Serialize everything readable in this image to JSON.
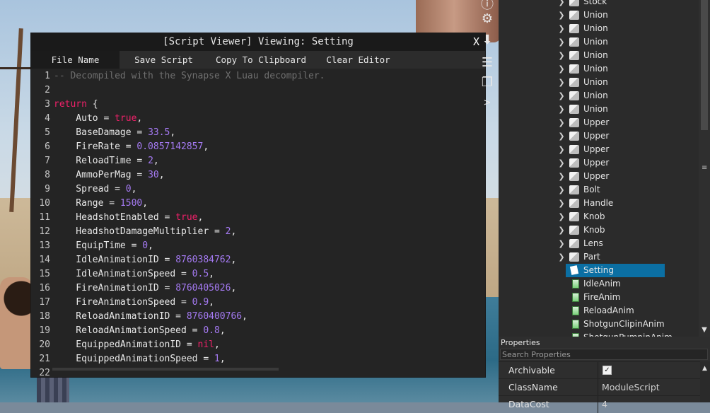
{
  "viewer": {
    "title": "[Script Viewer] Viewing: Setting",
    "close_label": "X",
    "tabs": [
      {
        "label": "File Name"
      },
      {
        "label": "Save Script"
      },
      {
        "label": "Copy To Clipboard"
      },
      {
        "label": "Clear Editor"
      }
    ],
    "lines": [
      {
        "n": "1",
        "tokens": [
          {
            "t": "-- Decompiled with the Synapse X Luau decompiler.",
            "c": "cm"
          }
        ]
      },
      {
        "n": "2",
        "tokens": []
      },
      {
        "n": "3",
        "tokens": [
          {
            "t": "return",
            "c": "kw"
          },
          {
            "t": " {",
            "c": "op"
          }
        ]
      },
      {
        "n": "4",
        "tokens": [
          {
            "t": "    Auto = ",
            "c": "op"
          },
          {
            "t": "true",
            "c": "kw"
          },
          {
            "t": ",",
            "c": "op"
          }
        ]
      },
      {
        "n": "5",
        "tokens": [
          {
            "t": "    BaseDamage = ",
            "c": "op"
          },
          {
            "t": "33.5",
            "c": "num"
          },
          {
            "t": ",",
            "c": "op"
          }
        ]
      },
      {
        "n": "6",
        "tokens": [
          {
            "t": "    FireRate = ",
            "c": "op"
          },
          {
            "t": "0.0857142857",
            "c": "num"
          },
          {
            "t": ",",
            "c": "op"
          }
        ]
      },
      {
        "n": "7",
        "tokens": [
          {
            "t": "    ReloadTime = ",
            "c": "op"
          },
          {
            "t": "2",
            "c": "num"
          },
          {
            "t": ",",
            "c": "op"
          }
        ]
      },
      {
        "n": "8",
        "tokens": [
          {
            "t": "    AmmoPerMag = ",
            "c": "op"
          },
          {
            "t": "30",
            "c": "num"
          },
          {
            "t": ",",
            "c": "op"
          }
        ]
      },
      {
        "n": "9",
        "tokens": [
          {
            "t": "    Spread = ",
            "c": "op"
          },
          {
            "t": "0",
            "c": "num"
          },
          {
            "t": ",",
            "c": "op"
          }
        ]
      },
      {
        "n": "10",
        "tokens": [
          {
            "t": "    Range = ",
            "c": "op"
          },
          {
            "t": "1500",
            "c": "num"
          },
          {
            "t": ",",
            "c": "op"
          }
        ]
      },
      {
        "n": "11",
        "tokens": [
          {
            "t": "    HeadshotEnabled = ",
            "c": "op"
          },
          {
            "t": "true",
            "c": "kw"
          },
          {
            "t": ",",
            "c": "op"
          }
        ]
      },
      {
        "n": "12",
        "tokens": [
          {
            "t": "    HeadshotDamageMultiplier = ",
            "c": "op"
          },
          {
            "t": "2",
            "c": "num"
          },
          {
            "t": ",",
            "c": "op"
          }
        ]
      },
      {
        "n": "13",
        "tokens": [
          {
            "t": "    EquipTime = ",
            "c": "op"
          },
          {
            "t": "0",
            "c": "num"
          },
          {
            "t": ",",
            "c": "op"
          }
        ]
      },
      {
        "n": "14",
        "tokens": [
          {
            "t": "    IdleAnimationID = ",
            "c": "op"
          },
          {
            "t": "8760384762",
            "c": "num"
          },
          {
            "t": ",",
            "c": "op"
          }
        ]
      },
      {
        "n": "15",
        "tokens": [
          {
            "t": "    IdleAnimationSpeed = ",
            "c": "op"
          },
          {
            "t": "0.5",
            "c": "num"
          },
          {
            "t": ",",
            "c": "op"
          }
        ]
      },
      {
        "n": "16",
        "tokens": [
          {
            "t": "    FireAnimationID = ",
            "c": "op"
          },
          {
            "t": "8760405026",
            "c": "num"
          },
          {
            "t": ",",
            "c": "op"
          }
        ]
      },
      {
        "n": "17",
        "tokens": [
          {
            "t": "    FireAnimationSpeed = ",
            "c": "op"
          },
          {
            "t": "0.9",
            "c": "num"
          },
          {
            "t": ",",
            "c": "op"
          }
        ]
      },
      {
        "n": "18",
        "tokens": [
          {
            "t": "    ReloadAnimationID = ",
            "c": "op"
          },
          {
            "t": "8760400766",
            "c": "num"
          },
          {
            "t": ",",
            "c": "op"
          }
        ]
      },
      {
        "n": "19",
        "tokens": [
          {
            "t": "    ReloadAnimationSpeed = ",
            "c": "op"
          },
          {
            "t": "0.8",
            "c": "num"
          },
          {
            "t": ",",
            "c": "op"
          }
        ]
      },
      {
        "n": "20",
        "tokens": [
          {
            "t": "    EquippedAnimationID = ",
            "c": "op"
          },
          {
            "t": "nil",
            "c": "kw"
          },
          {
            "t": ",",
            "c": "op"
          }
        ]
      },
      {
        "n": "21",
        "tokens": [
          {
            "t": "    EquippedAnimationSpeed = ",
            "c": "op"
          },
          {
            "t": "1",
            "c": "num"
          },
          {
            "t": ",",
            "c": "op"
          }
        ]
      },
      {
        "n": "22",
        "tokens": []
      }
    ]
  },
  "sidebar_icons": [
    "info-icon",
    "gear-icon",
    "download-icon",
    "menu-icon",
    "window-icon",
    "arrow-right-icon"
  ],
  "explorer": {
    "items": [
      {
        "label": "Stock",
        "icon": "union",
        "arrow": true
      },
      {
        "label": "Union",
        "icon": "union",
        "arrow": true
      },
      {
        "label": "Union",
        "icon": "union",
        "arrow": true
      },
      {
        "label": "Union",
        "icon": "union",
        "arrow": true
      },
      {
        "label": "Union",
        "icon": "union",
        "arrow": true
      },
      {
        "label": "Union",
        "icon": "union",
        "arrow": true
      },
      {
        "label": "Union",
        "icon": "union",
        "arrow": true
      },
      {
        "label": "Union",
        "icon": "union",
        "arrow": true
      },
      {
        "label": "Union",
        "icon": "union",
        "arrow": true
      },
      {
        "label": "Upper",
        "icon": "union",
        "arrow": true
      },
      {
        "label": "Upper",
        "icon": "union",
        "arrow": true
      },
      {
        "label": "Upper",
        "icon": "union",
        "arrow": true
      },
      {
        "label": "Upper",
        "icon": "union",
        "arrow": true
      },
      {
        "label": "Upper",
        "icon": "union",
        "arrow": true
      },
      {
        "label": "Bolt",
        "icon": "union",
        "arrow": true
      },
      {
        "label": "Handle",
        "icon": "union",
        "arrow": true
      },
      {
        "label": "Knob",
        "icon": "union",
        "arrow": true
      },
      {
        "label": "Knob",
        "icon": "union",
        "arrow": true
      },
      {
        "label": "Lens",
        "icon": "union",
        "arrow": true
      },
      {
        "label": "Part",
        "icon": "union",
        "arrow": true
      },
      {
        "label": "Setting",
        "icon": "script-sel",
        "arrow": false,
        "selected": true
      },
      {
        "label": "IdleAnim",
        "icon": "module",
        "arrow": false
      },
      {
        "label": "FireAnim",
        "icon": "module",
        "arrow": false
      },
      {
        "label": "ReloadAnim",
        "icon": "module",
        "arrow": false
      },
      {
        "label": "ShotgunClipinAnim",
        "icon": "module",
        "arrow": false
      },
      {
        "label": "ShotgunPumpinAnim",
        "icon": "module",
        "arrow": false
      }
    ]
  },
  "properties": {
    "title": "Properties",
    "search_placeholder": "Search Properties",
    "rows": [
      {
        "name": "Archivable",
        "value": "",
        "check": true
      },
      {
        "name": "ClassName",
        "value": "ModuleScript",
        "check": false
      },
      {
        "name": "DataCost",
        "value": "4",
        "check": false
      }
    ]
  },
  "colors": {
    "keyword": "#f0216a",
    "number": "#a57af3",
    "comment": "#6f6f6f",
    "selection": "#0b6fa3"
  }
}
